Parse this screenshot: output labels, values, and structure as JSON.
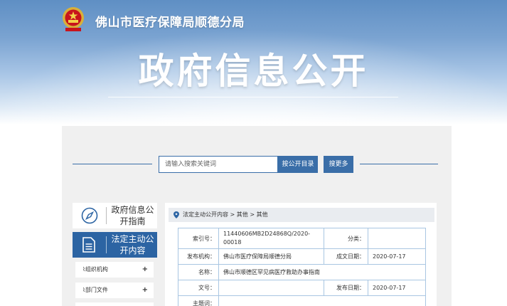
{
  "header": {
    "site_name": "佛山市医疗保障局顺德分局",
    "title": "政府信息公开",
    "emblem_icon": "national-emblem-icon"
  },
  "search": {
    "placeholder": "请输入搜索关键词",
    "search_button": "按公开目录",
    "more_button": "搜更多"
  },
  "sidebar": {
    "guide_label": "政府信息公开指南",
    "guide_icon": "compass-icon",
    "legal_label": "法定主动公开内容",
    "legal_icon": "document-icon",
    "items": [
      {
        "label": "组织机构",
        "icon": "clip-icon"
      },
      {
        "label": "部门文件",
        "icon": "clip-icon"
      }
    ]
  },
  "breadcrumb": {
    "path": "法定主动公开内容 > 其他 > 其他"
  },
  "info_table": {
    "index_label": "索引号：",
    "index_value": "11440606MB2D24868Q/2020-00018",
    "category_label": "分类：",
    "category_value": "",
    "publisher_label": "发布机构：",
    "publisher_value": "佛山市医疗保障局顺德分局",
    "created_label": "成文日期：",
    "created_value": "2020-07-17",
    "name_label": "名称：",
    "name_value": "佛山市顺德区罕见病医疗救助办事指南",
    "doc_no_label": "文号：",
    "doc_no_value": "",
    "published_label": "发布日期：",
    "published_value": "2020-07-17",
    "subject_label": "主题词："
  },
  "colors": {
    "accent": "#3a6ea8",
    "legal_bg": "#2c64a3",
    "panel_bg": "#f0f0f0"
  }
}
